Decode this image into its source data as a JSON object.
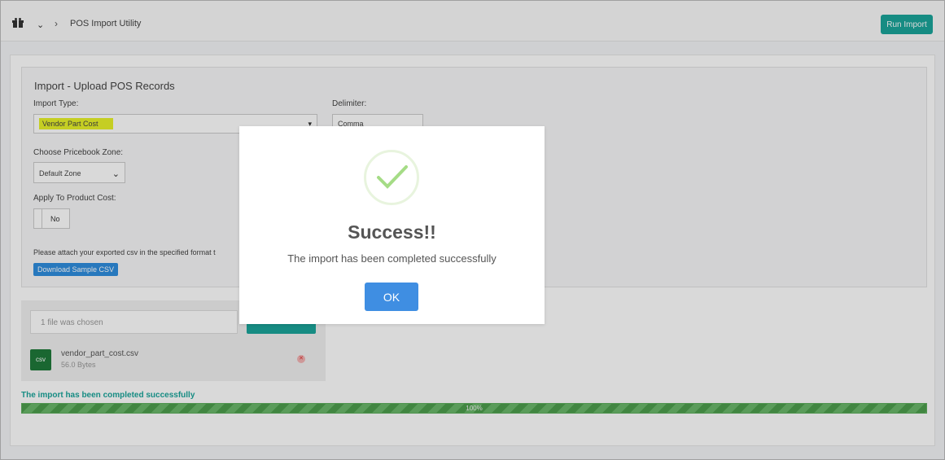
{
  "topbar": {
    "breadcrumb": "POS Import Utility",
    "run_button": "Run Import",
    "icons": [
      "gift-icon",
      "chevron-down-icon",
      "chevron-right-icon"
    ]
  },
  "form": {
    "title": "Import - Upload POS Records",
    "import_type_label": "Import Type:",
    "import_type_value": "Vendor Part Cost",
    "delimiter_label": "Delimiter:",
    "delimiter_value": "Comma",
    "pricebook_label": "Choose Pricebook Zone:",
    "pricebook_value": "Default Zone",
    "apply_cost_label": "Apply To Product Cost:",
    "apply_cost_value": "No",
    "attach_text": "Please attach your exported csv in the specified format t",
    "download_button": "Download Sample CSV"
  },
  "upload": {
    "file_chosen": "1 file was chosen",
    "file_icon": "csv",
    "file_name": "vendor_part_cost.csv",
    "file_size": "56.0 Bytes"
  },
  "progress": {
    "status": "The import has been completed successfully",
    "percent_label": "100%",
    "value": 1.0
  },
  "modal": {
    "title": "Success!!",
    "message": "The import has been completed successfully",
    "ok_button": "OK"
  },
  "colors": {
    "accent": "#1ba59b",
    "primary": "#3f8ee2",
    "highlight": "#e8f32a",
    "progress": "#4d9e4d"
  }
}
